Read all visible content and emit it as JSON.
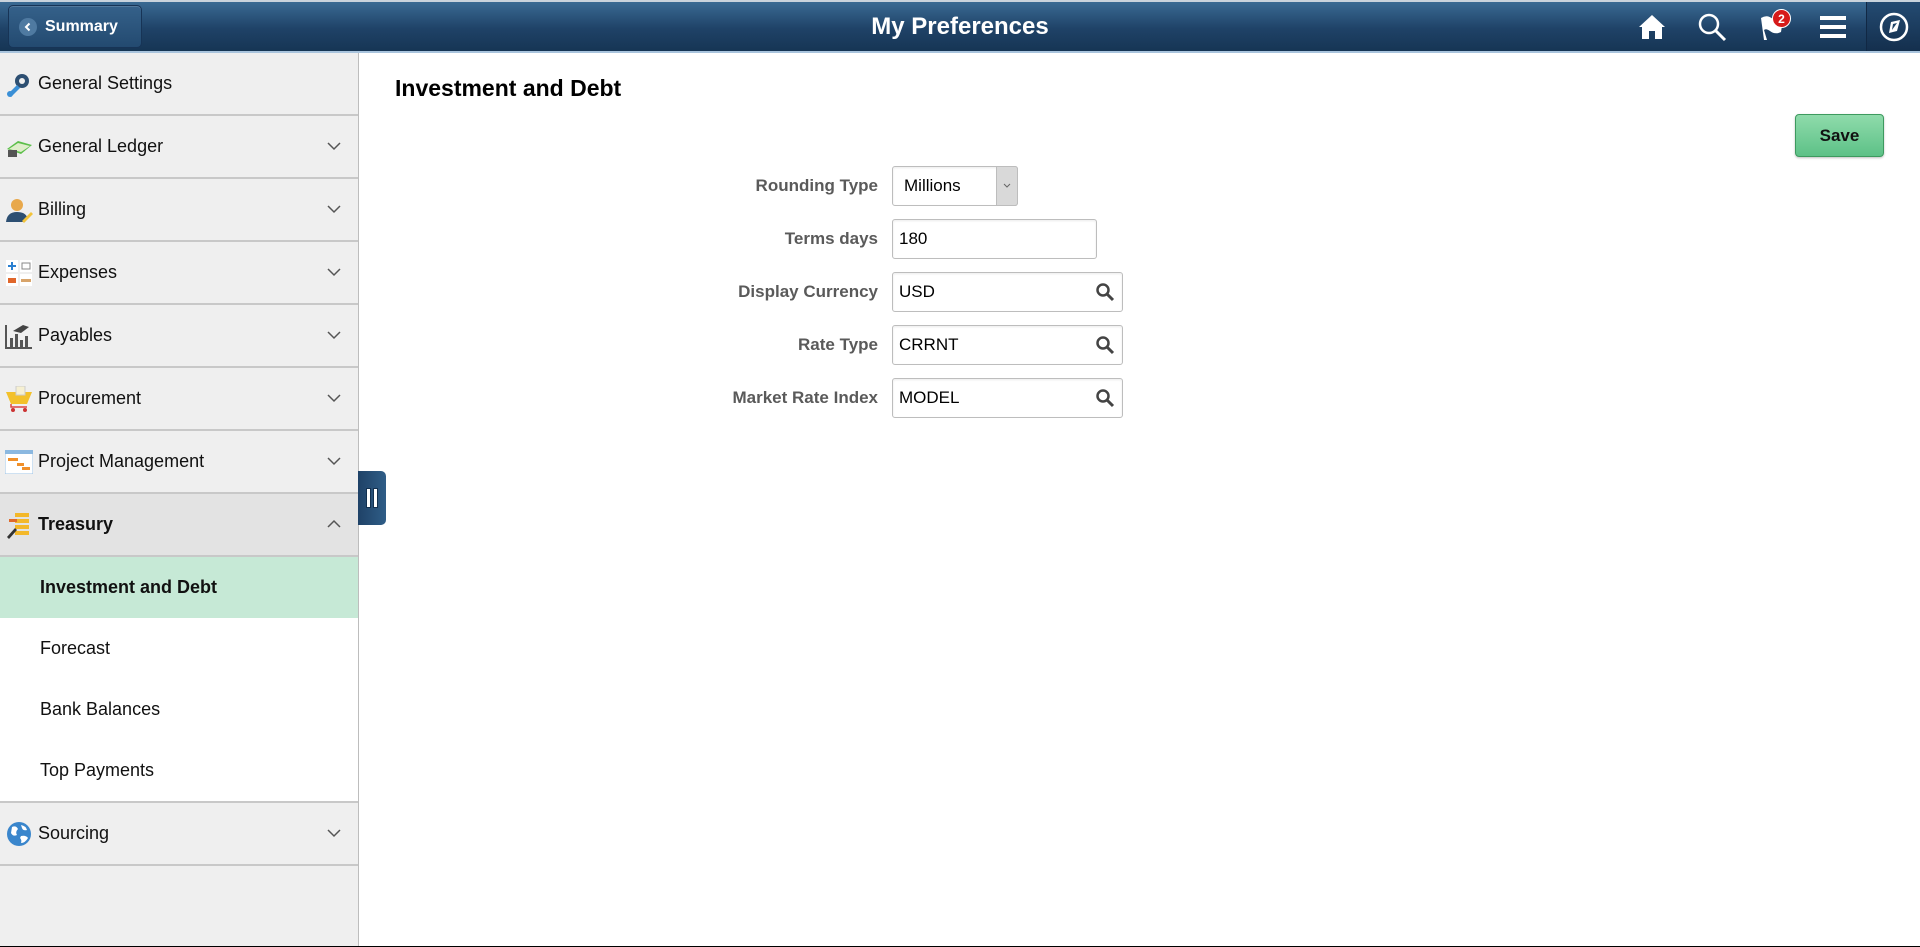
{
  "header": {
    "back_label": "Summary",
    "title": "My Preferences",
    "notification_count": "2",
    "icons": [
      "home-icon",
      "search-icon",
      "notification-flag-icon",
      "menu-icon",
      "navbar-compass-icon"
    ]
  },
  "sidebar": {
    "items": [
      {
        "label": "General Settings",
        "icon": "wrench-gear-icon",
        "expandable": false
      },
      {
        "label": "General Ledger",
        "icon": "ledger-book-icon",
        "expandable": true
      },
      {
        "label": "Billing",
        "icon": "person-pencil-icon",
        "expandable": true
      },
      {
        "label": "Expenses",
        "icon": "travel-expenses-icon",
        "expandable": true
      },
      {
        "label": "Payables",
        "icon": "bar-chart-hand-icon",
        "expandable": true
      },
      {
        "label": "Procurement",
        "icon": "shopping-cart-icon",
        "expandable": true
      },
      {
        "label": "Project Management",
        "icon": "gantt-chart-icon",
        "expandable": true
      },
      {
        "label": "Treasury",
        "icon": "treasury-coins-icon",
        "expandable": true,
        "expanded": true
      },
      {
        "label": "Sourcing",
        "icon": "globe-icon",
        "expandable": true
      }
    ],
    "treasury_sub_items": [
      {
        "label": "Investment and Debt",
        "selected": true
      },
      {
        "label": "Forecast"
      },
      {
        "label": "Bank Balances"
      },
      {
        "label": "Top Payments"
      }
    ]
  },
  "main": {
    "title": "Investment and Debt",
    "save_label": "Save",
    "form": {
      "rounding_type": {
        "label": "Rounding Type",
        "value": "Millions"
      },
      "terms_days": {
        "label": "Terms days",
        "value": "180"
      },
      "display_currency": {
        "label": "Display Currency",
        "value": "USD"
      },
      "rate_type": {
        "label": "Rate Type",
        "value": "CRRNT"
      },
      "market_rate_index": {
        "label": "Market Rate Index",
        "value": "MODEL"
      }
    }
  },
  "colors": {
    "header_bg": "#1f4267",
    "selected_item_bg": "#c6e9d6",
    "save_button": "#6fca93",
    "badge": "#d61a1a"
  }
}
